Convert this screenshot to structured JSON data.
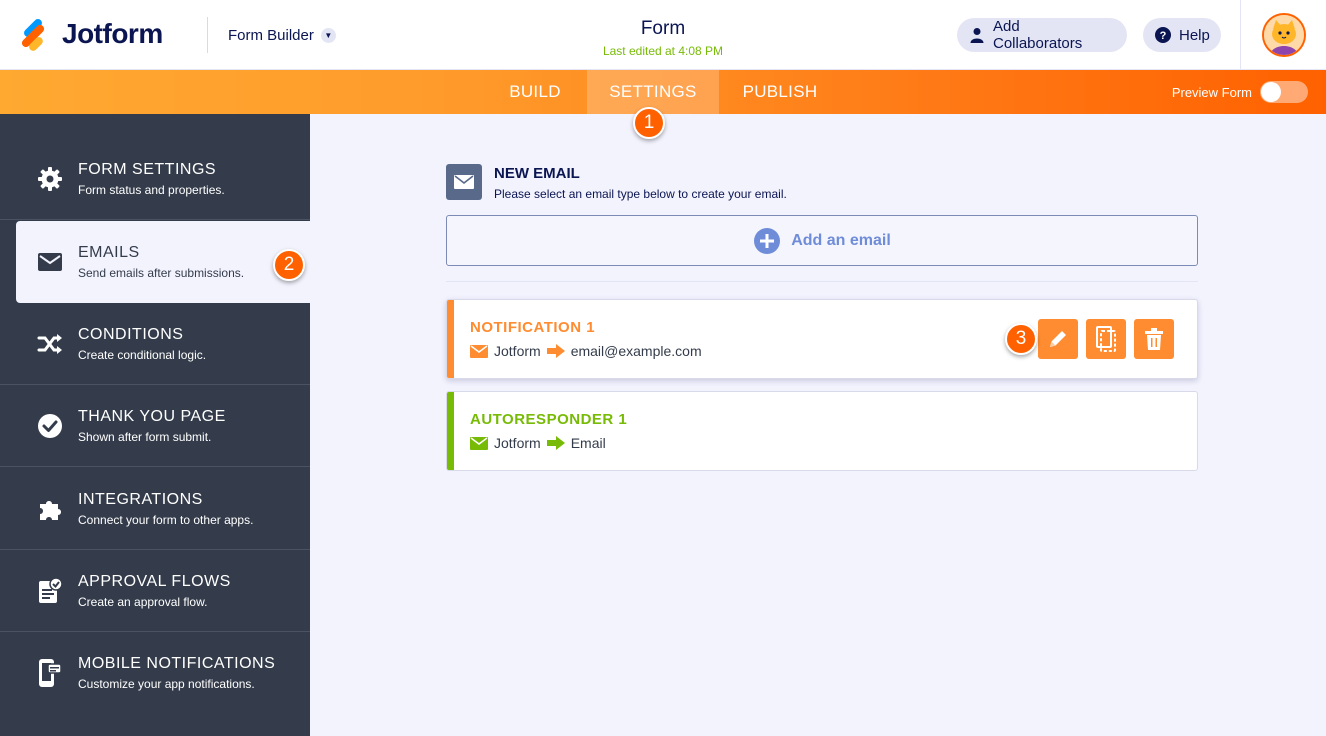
{
  "header": {
    "logo_text": "Jotform",
    "builder_label": "Form Builder",
    "form_title": "Form",
    "last_edited": "Last edited at 4:08 PM",
    "collaborators_label": "Add Collaborators",
    "help_label": "Help"
  },
  "nav": {
    "tabs": [
      {
        "label": "BUILD"
      },
      {
        "label": "SETTINGS"
      },
      {
        "label": "PUBLISH"
      }
    ],
    "active_tab": "SETTINGS",
    "preview_label": "Preview Form"
  },
  "badges": {
    "settings": "1",
    "emails": "2",
    "edit": "3"
  },
  "sidebar": {
    "items": [
      {
        "title": "FORM SETTINGS",
        "desc": "Form status and properties."
      },
      {
        "title": "EMAILS",
        "desc": "Send emails after submissions."
      },
      {
        "title": "CONDITIONS",
        "desc": "Create conditional logic."
      },
      {
        "title": "THANK YOU PAGE",
        "desc": "Shown after form submit."
      },
      {
        "title": "INTEGRATIONS",
        "desc": "Connect your form to other apps."
      },
      {
        "title": "APPROVAL FLOWS",
        "desc": "Create an approval flow."
      },
      {
        "title": "MOBILE NOTIFICATIONS",
        "desc": "Customize your app notifications."
      }
    ],
    "active": "EMAILS"
  },
  "main": {
    "new_email_title": "NEW EMAIL",
    "new_email_desc": "Please select an email type below to create your email.",
    "add_email_label": "Add an email",
    "emails": [
      {
        "title": "NOTIFICATION 1",
        "from": "Jotform",
        "to": "email@example.com",
        "color": "#ff8c30"
      },
      {
        "title": "AUTORESPONDER 1",
        "from": "Jotform",
        "to": "Email",
        "color": "#78bb07"
      }
    ]
  },
  "colors": {
    "accent_orange": "#ff6100",
    "sidebar_bg": "#343c4b",
    "autoresponder_green": "#78bb07",
    "notification_orange": "#ff8c30"
  }
}
